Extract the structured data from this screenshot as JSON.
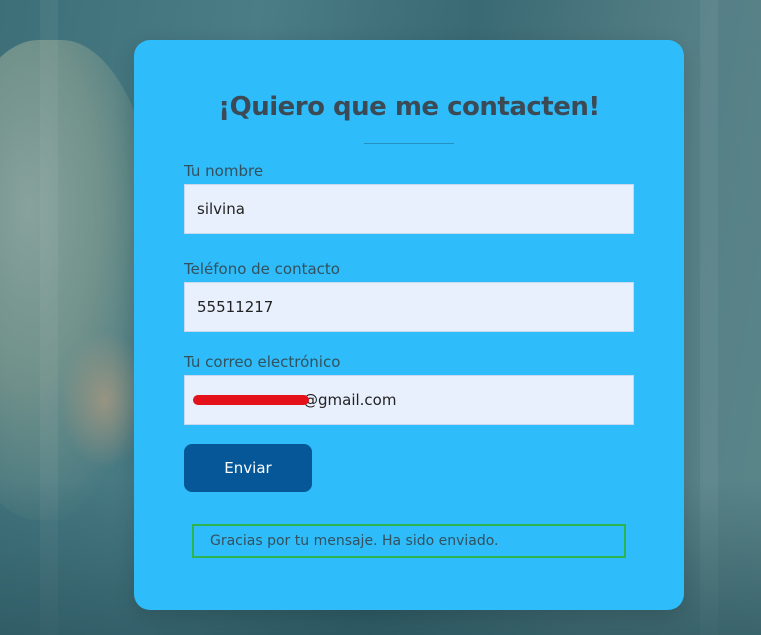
{
  "form": {
    "title": "¡Quiero que me contacten!",
    "fields": [
      {
        "label": "Tu nombre",
        "value": "silvina"
      },
      {
        "label": "Teléfono de contacto",
        "value": "55511217"
      },
      {
        "label": "Tu correo electrónico",
        "value_visible_suffix": "@gmail.com"
      }
    ],
    "submit_label": "Enviar",
    "success_message": "Gracias por tu mensaje. Ha sido enviado."
  },
  "colors": {
    "card_background": "#2ebcfa",
    "title_text": "#3b4a55",
    "input_background": "#e9f0fd",
    "button_background": "#055797",
    "button_text": "#ffffff",
    "success_border": "#2db44f",
    "redaction_mark": "#e4111a"
  }
}
